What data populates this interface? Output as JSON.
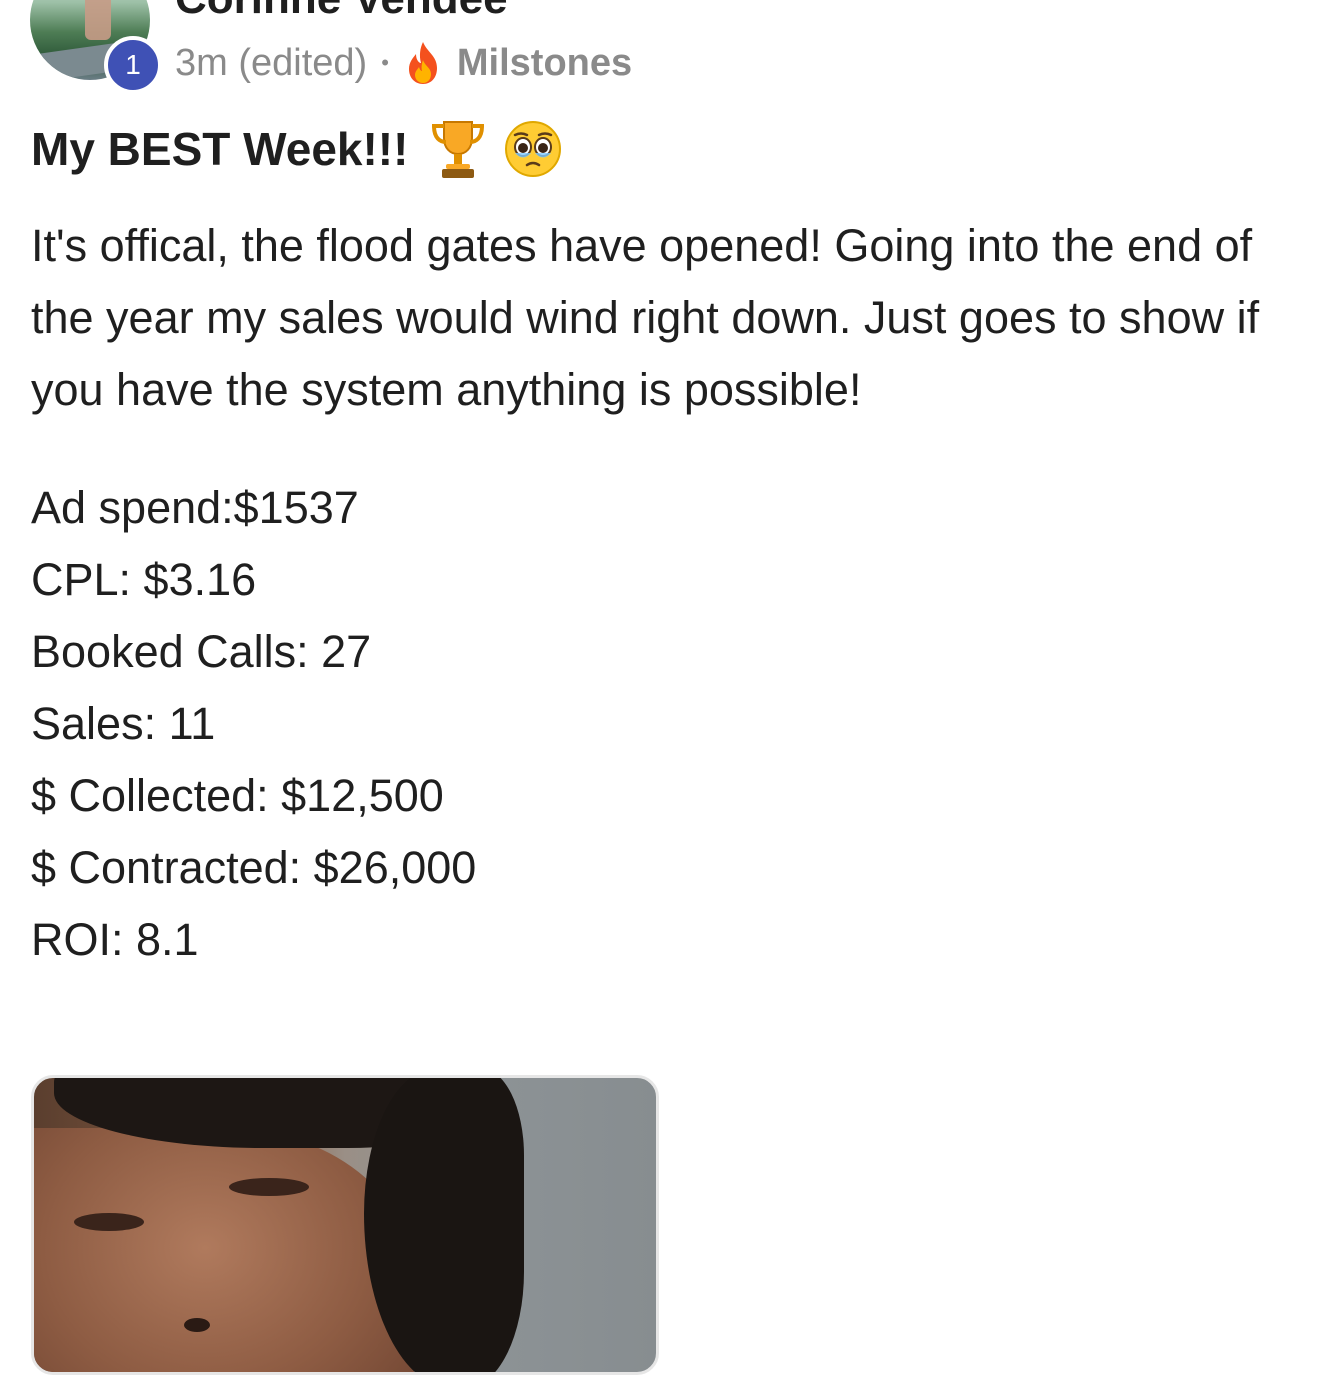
{
  "post": {
    "author": {
      "name": "Corinne Vendee",
      "level": "1"
    },
    "meta": {
      "time": "3m (edited)",
      "separator": "•",
      "category": "Milstones",
      "category_icon": "fire-icon"
    },
    "title": "My BEST Week!!!",
    "title_icons": [
      "trophy-icon",
      "pleading-face-icon"
    ],
    "body": "It's offical, the flood gates have opened! Going into the end of the year my sales would wind right down. Just goes to show if you have the system anything is possible!",
    "stats": [
      "Ad spend:$1537",
      "CPL: $3.16",
      "Booked Calls: 27",
      "Sales: 11",
      "$ Collected: $12,500",
      "$ Contracted: $26,000",
      "ROI: 8.1"
    ]
  },
  "colors": {
    "level_badge": "#3f51b5",
    "meta_text": "#8a8a8a",
    "text": "#1f1f1f"
  }
}
